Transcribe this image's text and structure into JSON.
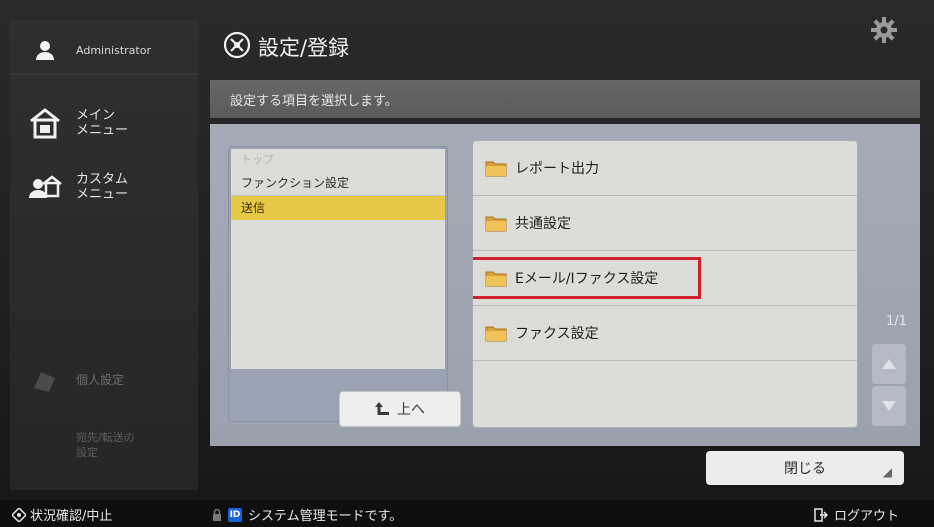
{
  "sidebar": {
    "user": "Administrator",
    "main_menu": "メイン\nメニュー",
    "custom_menu": "カスタム\nメニュー",
    "personal_settings": "個人設定",
    "destination": "宛先/転送の\n設定"
  },
  "header": {
    "title": "設定/登録",
    "instruction": "設定する項目を選択します。"
  },
  "tree": {
    "rows": [
      "トップ",
      "ファンクション設定",
      "送信"
    ],
    "selected_index": 2,
    "up_button": "上へ"
  },
  "items": [
    "レポート出力",
    "共通設定",
    "Eメール/Iファクス設定",
    "ファクス設定"
  ],
  "highlighted_item_index": 2,
  "pagination": {
    "page": "1/1"
  },
  "close_button": "閉じる",
  "status": {
    "left": "状況確認/中止",
    "message": "システム管理モードです。",
    "id_badge": "ID",
    "logout": "ログアウト"
  },
  "colors": {
    "selected_row": "#e4c846",
    "highlight_border": "#d0202a",
    "id_badge": "#1a63d6"
  }
}
